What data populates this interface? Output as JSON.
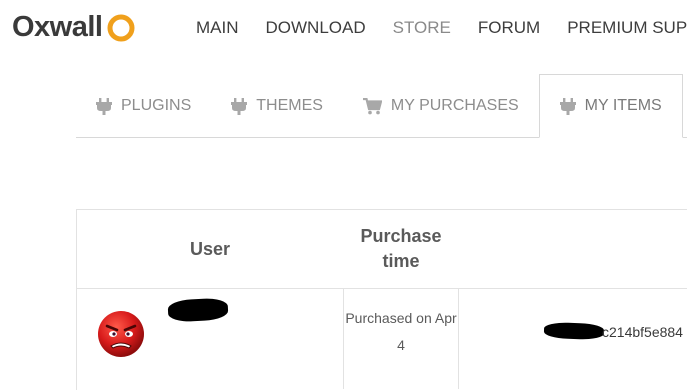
{
  "header": {
    "logo_text": "Oxwall",
    "nav": [
      {
        "label": "MAIN"
      },
      {
        "label": "DOWNLOAD"
      },
      {
        "label": "STORE"
      },
      {
        "label": "FORUM"
      },
      {
        "label": "PREMIUM SUPPO"
      }
    ]
  },
  "tabs": [
    {
      "label": "PLUGINS",
      "icon": "plug-icon"
    },
    {
      "label": "THEMES",
      "icon": "plug-icon"
    },
    {
      "label": "MY PURCHASES",
      "icon": "cart-icon"
    },
    {
      "label": "MY ITEMS",
      "icon": "plug-icon",
      "active": true
    }
  ],
  "table": {
    "headers": {
      "user": "User",
      "purchase_time": "Purchase time"
    },
    "rows": [
      {
        "purchase_time": "Purchased on Apr 4",
        "license_key_partial": "c214bf5e884"
      }
    ]
  },
  "colors": {
    "logo_ring": "#f0a01c",
    "text_dark": "#3d3d3d",
    "text_muted": "#8d8d8d",
    "border": "#d8d8d8",
    "avatar_red": "#d81b1b"
  }
}
